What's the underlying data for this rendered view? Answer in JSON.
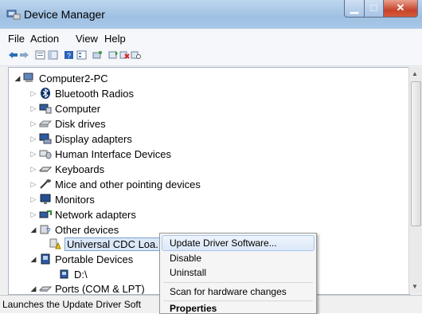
{
  "window": {
    "title": "Device Manager"
  },
  "menu": [
    "File",
    "Action",
    "View",
    "Help"
  ],
  "toolbar": [
    "back-icon",
    "forward-icon",
    "properties-icon",
    "show-hide-icon",
    "help-icon",
    "console-tree-icon",
    "scan-icon",
    "update-driver-icon",
    "uninstall-icon",
    "disable-icon"
  ],
  "tree": {
    "root": "Computer2-PC",
    "items": [
      {
        "label": "Bluetooth Radios",
        "icon": "bluetooth-icon"
      },
      {
        "label": "Computer",
        "icon": "computer-icon"
      },
      {
        "label": "Disk drives",
        "icon": "disk-drive-icon"
      },
      {
        "label": "Display adapters",
        "icon": "display-adapter-icon"
      },
      {
        "label": "Human Interface Devices",
        "icon": "hid-icon"
      },
      {
        "label": "Keyboards",
        "icon": "keyboard-icon"
      },
      {
        "label": "Mice and other pointing devices",
        "icon": "mouse-icon"
      },
      {
        "label": "Monitors",
        "icon": "monitor-icon"
      },
      {
        "label": "Network adapters",
        "icon": "network-adapter-icon"
      },
      {
        "label": "Other devices",
        "icon": "other-devices-icon"
      },
      {
        "label": "Universal CDC Loa...",
        "icon": "warning-device-icon"
      },
      {
        "label": "Portable Devices",
        "icon": "portable-device-icon"
      },
      {
        "label": "D:\\",
        "icon": "drive-icon"
      },
      {
        "label": "Ports (COM & LPT)",
        "icon": "port-icon"
      }
    ]
  },
  "context_menu": {
    "items": [
      "Update Driver Software...",
      "Disable",
      "Uninstall",
      "Scan for hardware changes",
      "Properties"
    ]
  },
  "status": {
    "text": "Launches the Update Driver Soft"
  }
}
